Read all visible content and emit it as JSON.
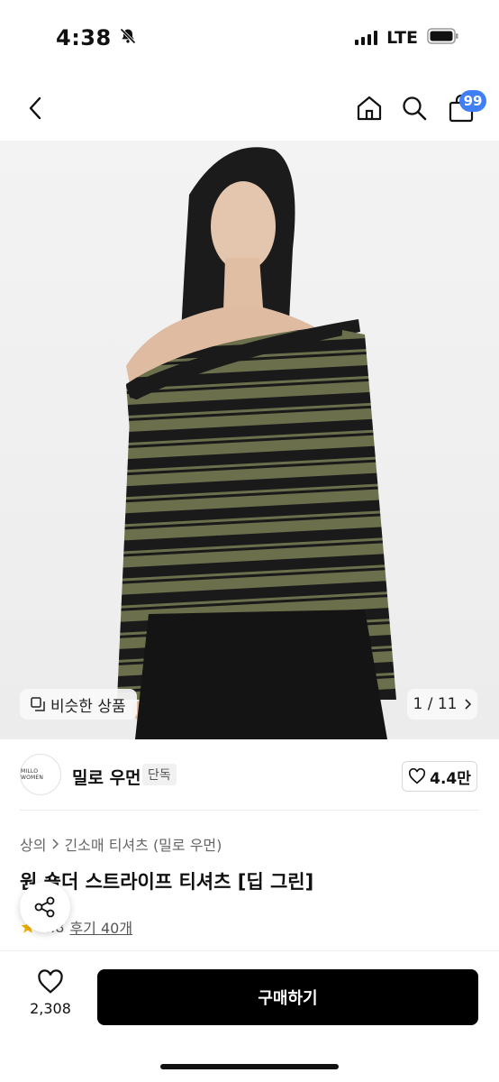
{
  "status_bar": {
    "time": "4:38",
    "network": "LTE"
  },
  "nav": {
    "cart_count": "99"
  },
  "image": {
    "similar_label": "비슷한 상품",
    "page_indicator": "1 / 11"
  },
  "brand": {
    "logo_text": "MILLO WOMEN",
    "name": "밀로 우먼",
    "badge": "단독",
    "likes": "4.4만"
  },
  "breadcrumb": {
    "category": "상의",
    "subcategory": "긴소매 티셔츠 (밀로 우먼)"
  },
  "product": {
    "title": "원 숄더 스트라이프 티셔츠 [딥 그린]",
    "rating": "4.8",
    "reviews_label": "후기 40개"
  },
  "bottom": {
    "wish_count": "2,308",
    "buy_label": "구매하기"
  },
  "colors": {
    "accent": "#3f7ef4",
    "primary_button": "#000000",
    "stripe_green": "#6b6f4c",
    "stripe_black": "#1a1a1a"
  }
}
